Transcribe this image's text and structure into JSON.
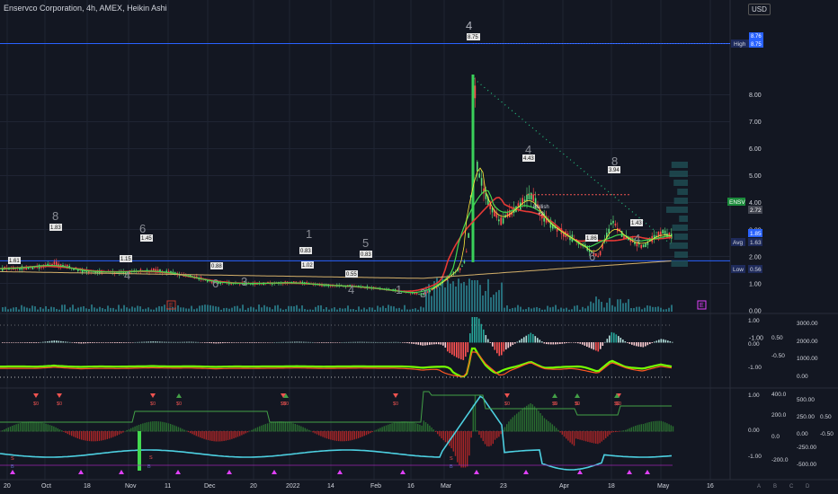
{
  "header": {
    "title": "Enservco Corporation, 4h, AMEX, Heikin Ashi",
    "currency": "USD"
  },
  "colors": {
    "background": "#131722",
    "blue_line": "#2962ff",
    "bull": "#26a69a",
    "bear": "#ef5350",
    "green_bright": "#4caf50",
    "lime": "#76ff03",
    "orange": "#ff9800",
    "gold": "#d4b06a",
    "cyan": "#4dd0e1",
    "magenta": "#e040fb"
  },
  "price_axis": {
    "ticks": [
      "8.00",
      "7.00",
      "6.00",
      "5.00",
      "4.00",
      "3.00",
      "2.00",
      "1.00",
      "0.00",
      "-1.00"
    ],
    "high_label": "High",
    "high_value": "8.75",
    "last_high_value": "8.76",
    "ticker_label": "ENSV",
    "last_price": "2.72",
    "blue_line_value": "1.85",
    "avg_label": "Avg",
    "avg_value": "1.63",
    "low_label": "Low",
    "low_value": "0.56"
  },
  "time_axis": {
    "labels": [
      "20",
      "Oct",
      "18",
      "Nov",
      "11",
      "Dec",
      "20",
      "2022",
      "14",
      "Feb",
      "16",
      "Mar",
      "23",
      "Apr",
      "18",
      "May",
      "16"
    ]
  },
  "price_annotations": {
    "top_label": "8.75",
    "peak_count": "4",
    "labels": [
      "1.61",
      "1.83",
      "1.15",
      "1.45",
      "0.88",
      "0.83",
      "1.02",
      "0.83",
      "0.55",
      "4.43",
      "3.94",
      "1.43",
      "1.86"
    ],
    "counts": [
      "8",
      "4",
      "6",
      "6",
      "3",
      "1",
      "5",
      "4",
      "1",
      "3",
      "4",
      "8",
      "6",
      "4"
    ],
    "bullish_text": "Bullish",
    "bullish_sub": "+2",
    "earnings_marker": "E"
  },
  "pane2_axis": {
    "left_ticks": [
      "1.00",
      "0.00",
      "-1.00"
    ],
    "mid_ticks": [
      "0.50",
      "-0.50"
    ],
    "right_ticks": [
      "3000.00",
      "2000.00",
      "1000.00",
      "0.00"
    ]
  },
  "pane3_axis": {
    "col1": [
      "1.00",
      "0.00",
      "-1.00"
    ],
    "col2": [
      "400.0",
      "200.0",
      "0.0",
      "-200.0"
    ],
    "col3": [
      "500.00",
      "250.00",
      "0.00",
      "-250.00",
      "-500.00"
    ],
    "col4": [
      "0.50",
      "-0.50"
    ]
  },
  "pane3_marks": {
    "down_label": "$0",
    "up_label": "$0",
    "sell_label": "S",
    "buy_label": "B",
    "axis_letters": [
      "A",
      "B",
      "C",
      "D"
    ]
  },
  "chart_data": {
    "type": "candlestick",
    "title": "Enservco Corporation, 4h, AMEX, Heikin Ashi",
    "x": [
      "Sep 20",
      "Oct",
      "Oct 18",
      "Nov",
      "Nov 11",
      "Dec",
      "Dec 20",
      "2022",
      "Jan 14",
      "Feb",
      "Feb 16",
      "Mar",
      "Mar 23",
      "Apr",
      "Apr 18",
      "May"
    ],
    "close_approx": [
      1.55,
      1.5,
      1.45,
      1.4,
      1.35,
      1.1,
      0.9,
      0.95,
      0.95,
      0.7,
      0.6,
      4.5,
      3.8,
      2.5,
      3.1,
      2.7
    ],
    "ylim": [
      -1.0,
      9.0
    ],
    "horizontal_levels": {
      "high": 8.75,
      "line": 1.85,
      "avg": 1.63,
      "low": 0.56
    },
    "last_price": 2.72
  }
}
